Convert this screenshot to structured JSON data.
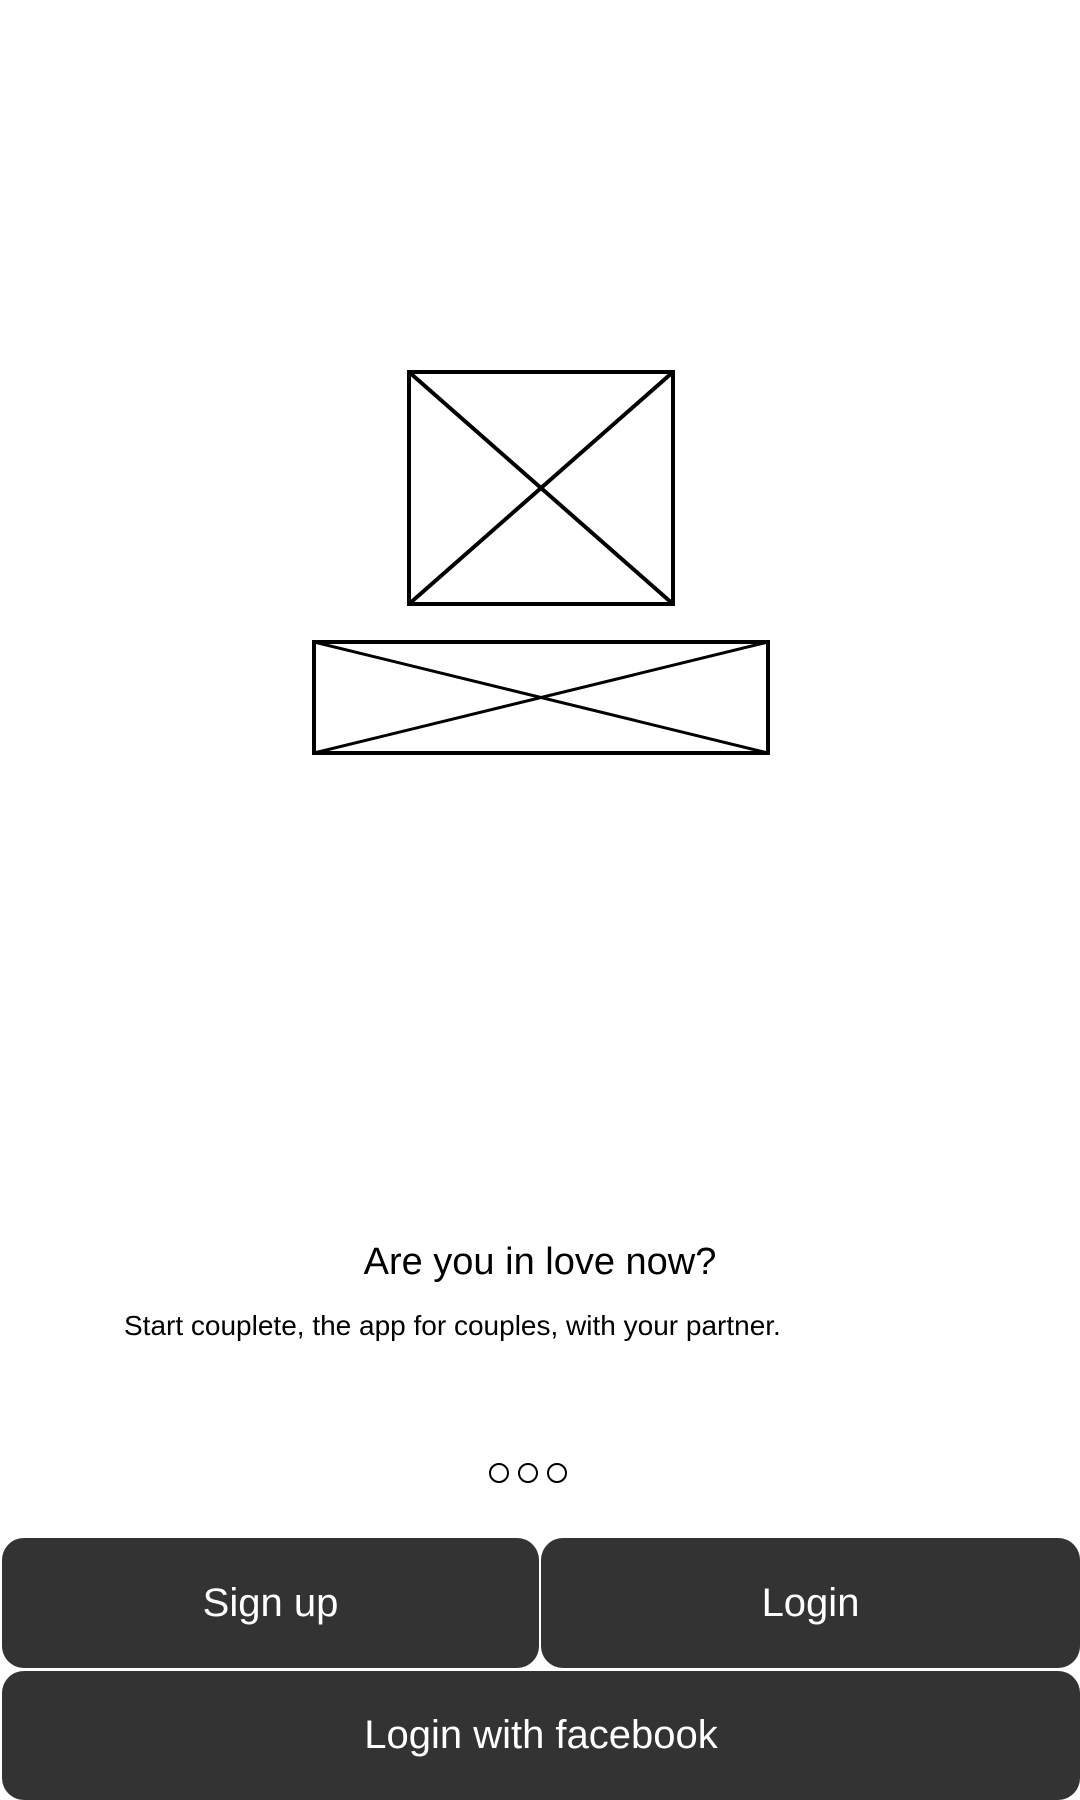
{
  "hero": {
    "logo_icon": "image-placeholder-icon",
    "wordmark_icon": "image-placeholder-icon"
  },
  "intro": {
    "headline": "Are you in love now?",
    "subtitle": "Start couplete, the app for couples, with your partner."
  },
  "pager": {
    "page_count": 3,
    "current_page": 1
  },
  "actions": {
    "signup_label": "Sign up",
    "login_label": "Login",
    "facebook_label": "Login with facebook"
  },
  "colors": {
    "button_bg": "#333333",
    "button_text": "#ffffff",
    "background": "#ffffff",
    "text": "#000000"
  }
}
